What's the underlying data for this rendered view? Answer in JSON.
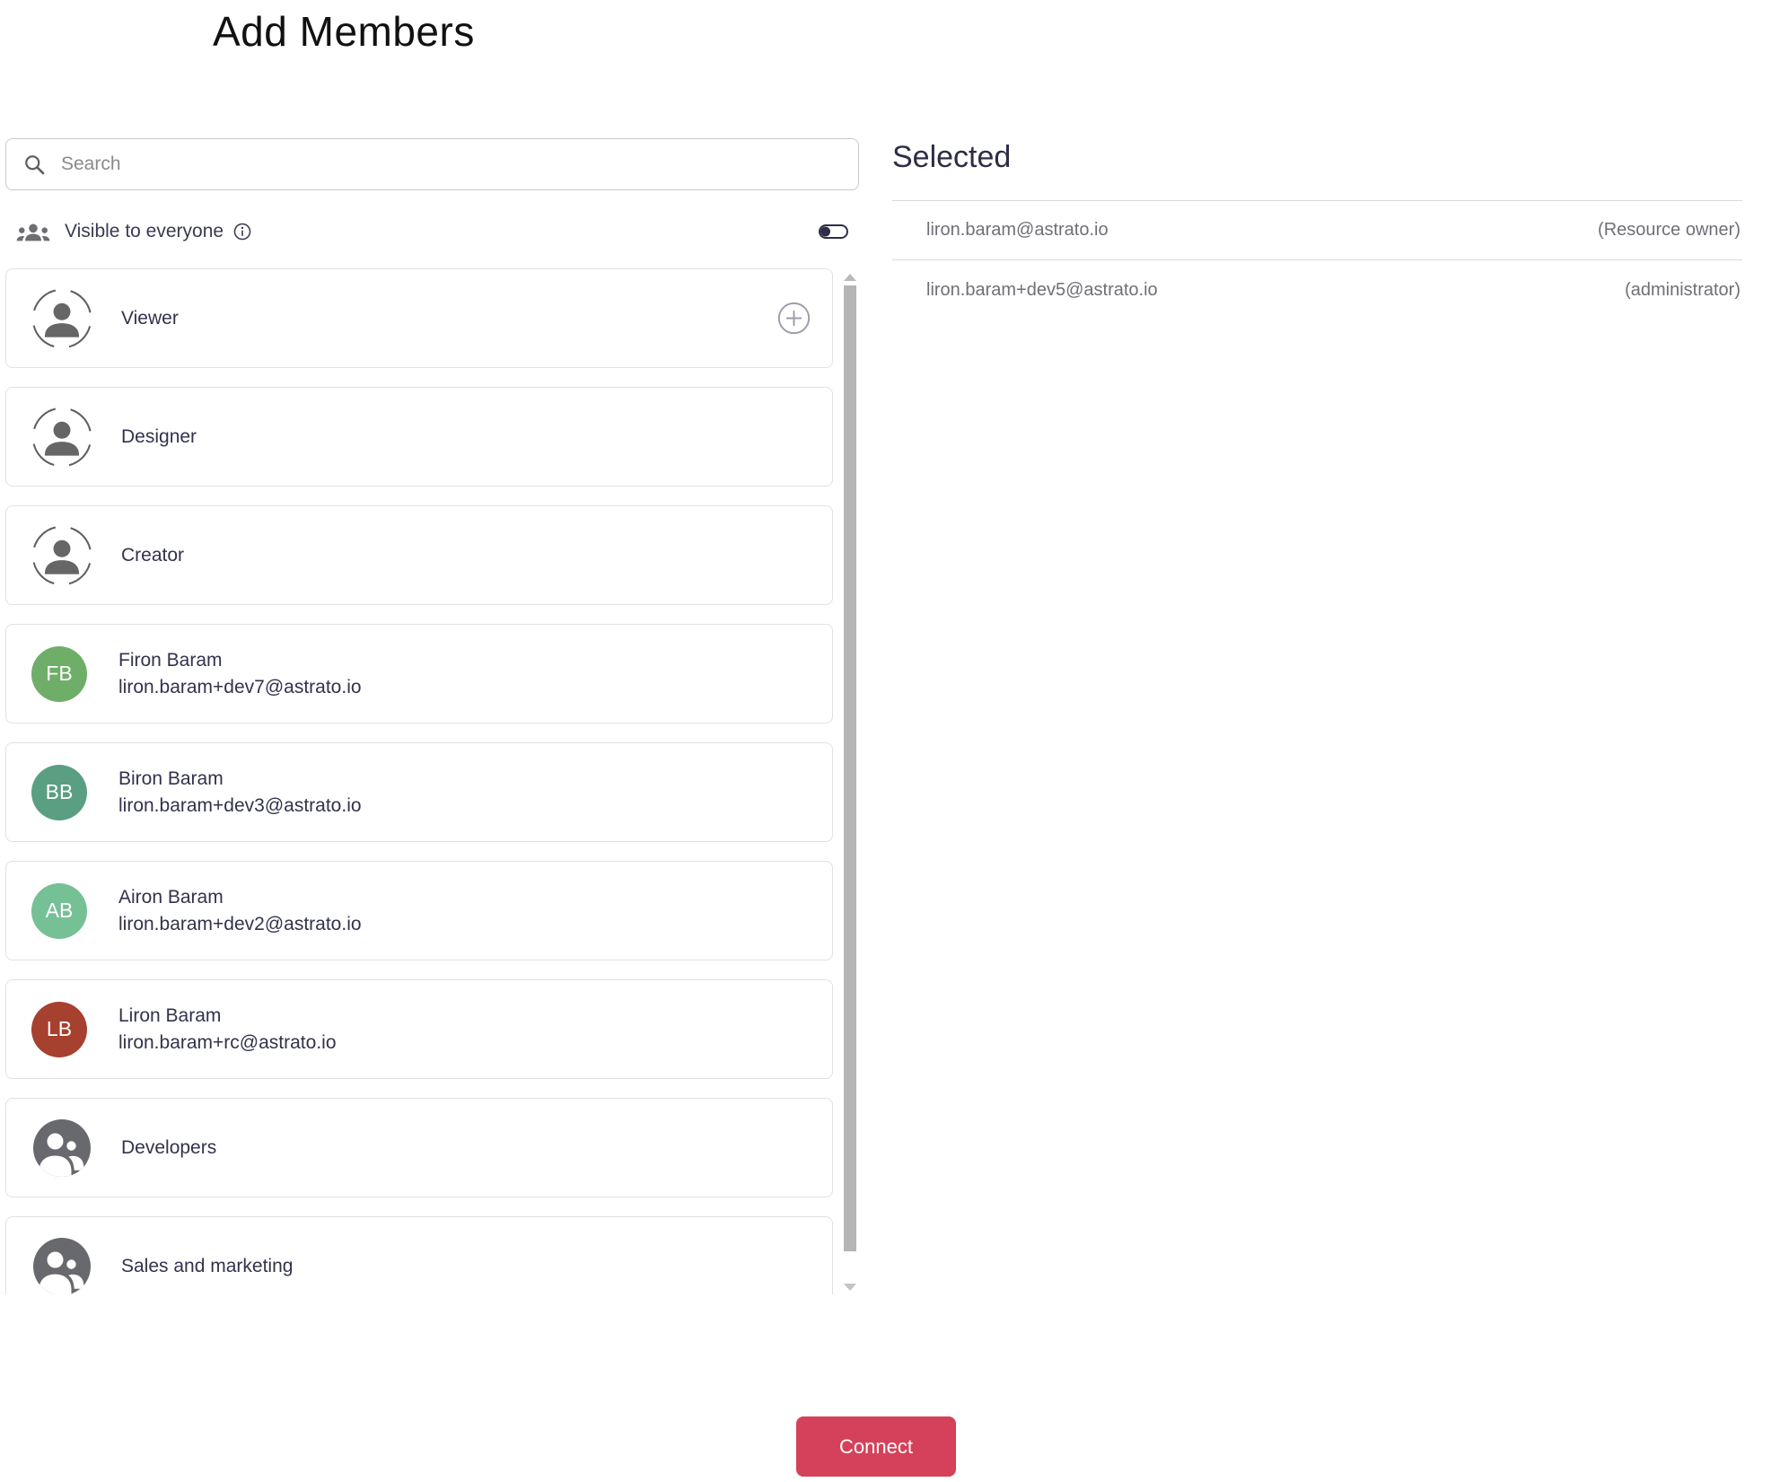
{
  "page": {
    "title": "Add Members"
  },
  "search": {
    "placeholder": "Search",
    "value": ""
  },
  "visibility": {
    "label": "Visible to everyone",
    "toggle_state": "off"
  },
  "list": {
    "items": [
      {
        "type": "role",
        "label": "Viewer",
        "has_add_button": true
      },
      {
        "type": "role",
        "label": "Designer"
      },
      {
        "type": "role",
        "label": "Creator"
      },
      {
        "type": "user",
        "name": "Firon Baram",
        "email": "liron.baram+dev7@astrato.io",
        "initials": "FB",
        "color": "#6fae69"
      },
      {
        "type": "user",
        "name": "Biron Baram",
        "email": "liron.baram+dev3@astrato.io",
        "initials": "BB",
        "color": "#5a9f82"
      },
      {
        "type": "user",
        "name": "Airon Baram",
        "email": "liron.baram+dev2@astrato.io",
        "initials": "AB",
        "color": "#76c096"
      },
      {
        "type": "user",
        "name": "Liron Baram",
        "email": "liron.baram+rc@astrato.io",
        "initials": "LB",
        "color": "#a6402f"
      },
      {
        "type": "group",
        "label": "Developers"
      },
      {
        "type": "group",
        "label": "Sales and marketing"
      }
    ]
  },
  "selected": {
    "heading": "Selected",
    "rows": [
      {
        "email": "liron.baram@astrato.io",
        "role": "(Resource owner)"
      },
      {
        "email": "liron.baram+dev5@astrato.io",
        "role": "(administrator)"
      }
    ]
  },
  "footer": {
    "connect_label": "Connect"
  },
  "colors": {
    "connect_button": "#d5415a",
    "toggle": "#2e2e48",
    "group_avatar": "#68686f",
    "text_primary": "#32324e",
    "text_secondary": "#6f6f78"
  }
}
